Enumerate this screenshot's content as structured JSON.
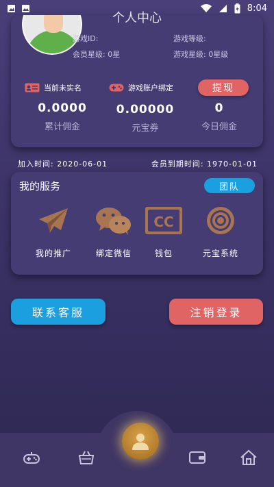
{
  "status_bar": {
    "time": "8:04"
  },
  "header": {
    "title": "个人中心"
  },
  "profile": {
    "game_id_label": "游戏ID:",
    "game_level_label": "游戏等级:",
    "member_star_label": "会员星级: 0星",
    "game_star_label": "游戏星级: 0星级",
    "realname_status": "当前未实名",
    "account_bind": "游戏账户绑定",
    "withdraw_label": "提现",
    "stats": [
      {
        "value": "0.0000",
        "label": "累计佣金"
      },
      {
        "value": "0.00000",
        "label": "元宝券"
      },
      {
        "value": "0",
        "label": "今日佣金"
      }
    ]
  },
  "dates": {
    "join": "加入时间: 2020-06-01",
    "expire": "会员到期时间: 1970-01-01"
  },
  "services": {
    "title": "我的服务",
    "team_label": "团队",
    "items": [
      {
        "label": "我的推广",
        "icon": "paper-plane-icon"
      },
      {
        "label": "绑定微信",
        "icon": "wechat-icon"
      },
      {
        "label": "钱包",
        "icon": "cc-card-icon"
      },
      {
        "label": "元宝系统",
        "icon": "target-circle-icon"
      }
    ]
  },
  "actions": {
    "contact": "联系客服",
    "logout": "注销登录"
  },
  "bottom_nav": {
    "items": [
      "gamepad-icon",
      "basket-icon",
      "user-icon",
      "wallet-icon",
      "home-icon"
    ]
  },
  "colors": {
    "accent_red": "#e06464",
    "accent_blue": "#1c9fde",
    "card_bg": "#453c73",
    "icon_bronze": "#b07a52"
  }
}
